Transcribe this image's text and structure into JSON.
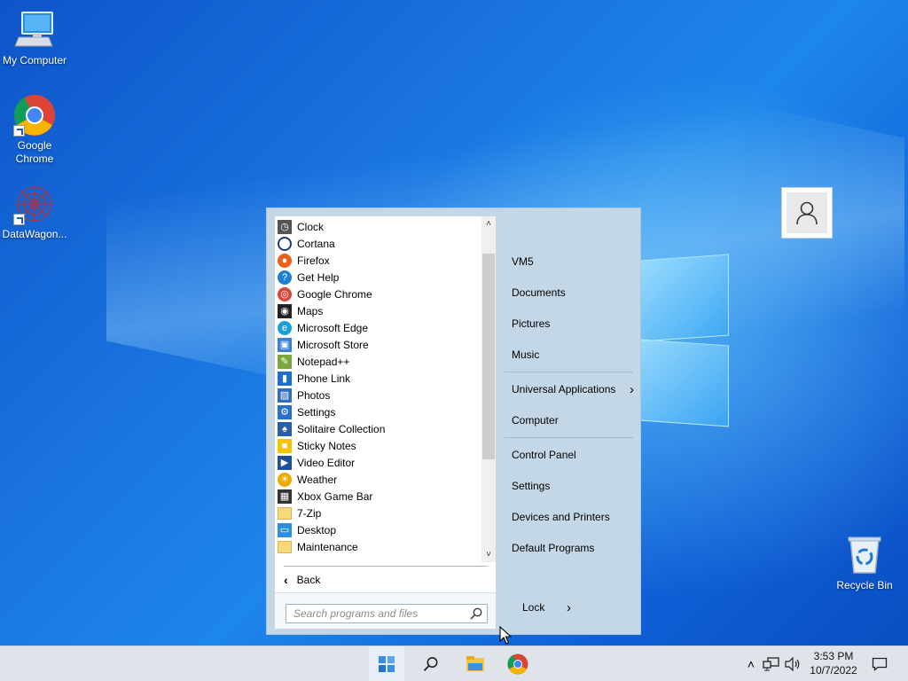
{
  "desktop": {
    "icons": [
      {
        "label": "My Computer"
      },
      {
        "label": "Google Chrome"
      },
      {
        "label": "DataWagon..."
      },
      {
        "label": "Recycle Bin"
      }
    ]
  },
  "start_menu": {
    "programs": [
      {
        "label": "Clock",
        "icon": "clock-icon",
        "color": "#555555"
      },
      {
        "label": "Cortana",
        "icon": "cortana-icon",
        "color": "#1a3b7a"
      },
      {
        "label": "Firefox",
        "icon": "firefox-icon",
        "color": "#e8621c"
      },
      {
        "label": "Get Help",
        "icon": "get-help-icon",
        "color": "#1e7fd0"
      },
      {
        "label": "Google Chrome",
        "icon": "chrome-icon",
        "color": "#db4437"
      },
      {
        "label": "Maps",
        "icon": "maps-icon",
        "color": "#222222"
      },
      {
        "label": "Microsoft Edge",
        "icon": "edge-icon",
        "color": "#1a9fd9"
      },
      {
        "label": "Microsoft Store",
        "icon": "store-icon",
        "color": "#3b7fd8"
      },
      {
        "label": "Notepad++",
        "icon": "notepadpp-icon",
        "color": "#7aa83c"
      },
      {
        "label": "Phone Link",
        "icon": "phone-link-icon",
        "color": "#1e6fcf"
      },
      {
        "label": "Photos",
        "icon": "photos-icon",
        "color": "#2f6fc0"
      },
      {
        "label": "Settings",
        "icon": "settings-gear-icon",
        "color": "#2a6fcf"
      },
      {
        "label": "Solitaire Collection",
        "icon": "solitaire-icon",
        "color": "#2a5fa8"
      },
      {
        "label": "Sticky Notes",
        "icon": "sticky-notes-icon",
        "color": "#f5c400"
      },
      {
        "label": "Video Editor",
        "icon": "video-editor-icon",
        "color": "#1d4f9a"
      },
      {
        "label": "Weather",
        "icon": "weather-icon",
        "color": "#f0a800"
      },
      {
        "label": "Xbox Game Bar",
        "icon": "xbox-game-bar-icon",
        "color": "#333333"
      },
      {
        "label": "7-Zip",
        "icon": "folder-icon",
        "color": "#f6d97a"
      },
      {
        "label": "Desktop",
        "icon": "desktop-icon",
        "color": "#2d8fe0"
      },
      {
        "label": "Maintenance",
        "icon": "folder-icon",
        "color": "#f6d97a"
      }
    ],
    "back_label": "Back",
    "search_placeholder": "Search programs and files",
    "right_items": {
      "vm5": "VM5",
      "documents": "Documents",
      "pictures": "Pictures",
      "music": "Music",
      "universal_apps": "Universal Applications",
      "computer": "Computer",
      "control_panel": "Control Panel",
      "settings": "Settings",
      "devices_printers": "Devices and Printers",
      "default_programs": "Default Programs",
      "lock": "Lock"
    }
  },
  "taskbar": {
    "time": "3:53 PM",
    "date": "10/7/2022"
  },
  "colors": {
    "accent": "#0a62d8",
    "menu_bg": "#c4d7e6",
    "taskbar_bg": "#dee4ea"
  }
}
